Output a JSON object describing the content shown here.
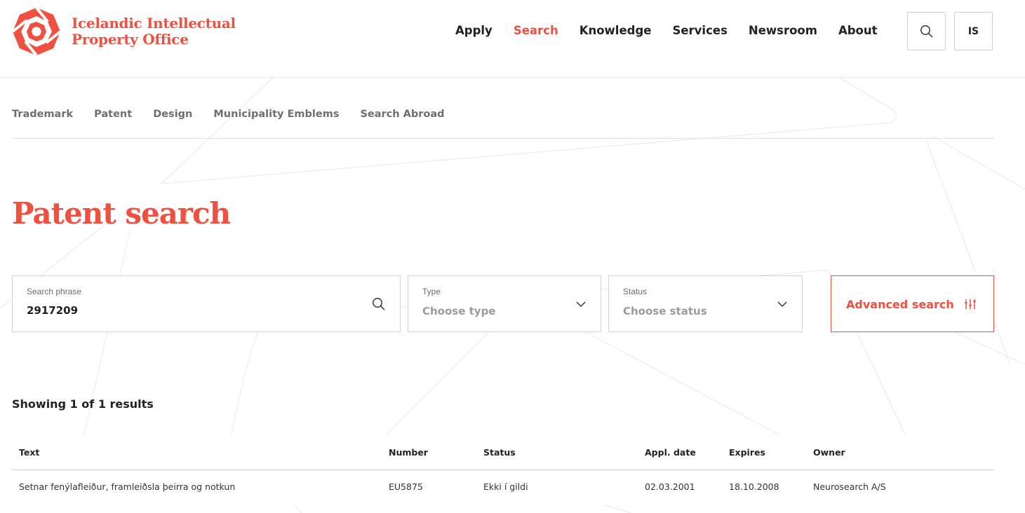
{
  "brand": {
    "line1": "Icelandic Intellectual",
    "line2": "Property Office",
    "color": "#ef5040"
  },
  "nav": {
    "items": [
      "Apply",
      "Search",
      "Knowledge",
      "Services",
      "Newsroom",
      "About"
    ],
    "active": "Search"
  },
  "header": {
    "search_icon": "search-icon",
    "language_label": "IS"
  },
  "subnav": {
    "items": [
      "Trademark",
      "Patent",
      "Design",
      "Municipality Emblems",
      "Search Abroad"
    ]
  },
  "page": {
    "title": "Patent search"
  },
  "search": {
    "phrase_label": "Search phrase",
    "phrase_value": "2917209",
    "type_label": "Type",
    "type_placeholder": "Choose type",
    "status_label": "Status",
    "status_placeholder": "Choose status",
    "advanced_label": "Advanced search",
    "advanced_icon": "sliders-icon"
  },
  "results": {
    "summary": "Showing 1 of 1 results",
    "columns": [
      "Text",
      "Number",
      "Status",
      "Appl. date",
      "Expires",
      "Owner"
    ],
    "rows": [
      [
        "Setnar fenýlafleiður, framleiðsla þeirra og notkun",
        "EU5875",
        "Ekki í gildi",
        "02.03.2001",
        "18.10.2008",
        "Neurosearch A/S"
      ]
    ]
  }
}
